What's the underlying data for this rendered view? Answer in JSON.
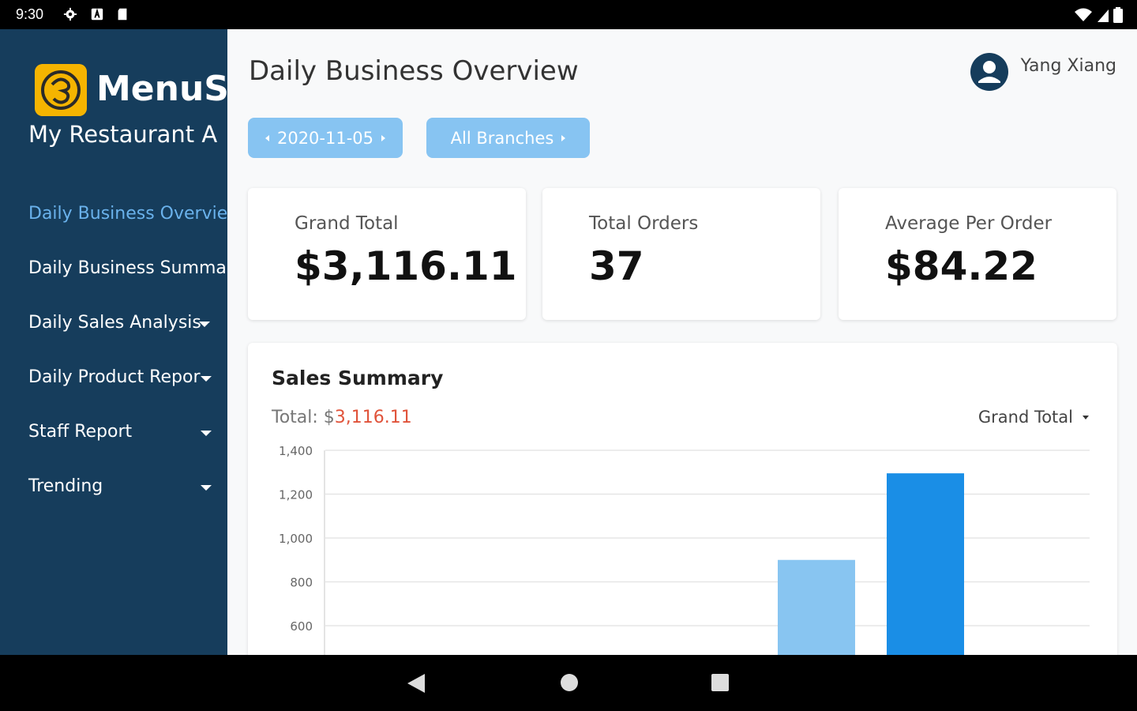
{
  "status_bar": {
    "time": "9:30",
    "left_icons": [
      "settings-icon",
      "notification-a-icon",
      "sd-card-icon"
    ],
    "right_icons": [
      "wifi-icon",
      "signal-icon",
      "battery-icon"
    ]
  },
  "sidebar": {
    "brand": "MenuSi",
    "restaurant": "My Restaurant A",
    "items": [
      {
        "label": "Daily Business Overvie",
        "active": true,
        "has_caret": false
      },
      {
        "label": "Daily Business Summa",
        "active": false,
        "has_caret": false
      },
      {
        "label": "Daily Sales Analysis",
        "active": false,
        "has_caret": true
      },
      {
        "label": "Daily Product Repor",
        "active": false,
        "has_caret": true
      },
      {
        "label": "Staff Report",
        "active": false,
        "has_caret": true
      },
      {
        "label": "Trending",
        "active": false,
        "has_caret": true
      }
    ]
  },
  "header": {
    "title": "Daily Business Overview",
    "user_name": "Yang Xiang"
  },
  "filters": {
    "date": "2020-11-05",
    "branch": "All Branches"
  },
  "kpis": [
    {
      "label": "Grand Total",
      "value": "$3,116.11"
    },
    {
      "label": "Total Orders",
      "value": "37"
    },
    {
      "label": "Average Per Order",
      "value": "$84.22"
    }
  ],
  "sales_summary": {
    "title": "Sales Summary",
    "total_label": "Total: $",
    "total_amount": "3,116.11",
    "metric": "Grand Total"
  },
  "chart_data": {
    "type": "bar",
    "y_ticks": [
      "1,400",
      "1,200",
      "1,000",
      "800",
      "600"
    ],
    "ylim": [
      600,
      1400
    ],
    "bars": [
      {
        "value": 900,
        "color": "#88c5f1"
      },
      {
        "value": 1295,
        "color": "#1a8ee6"
      }
    ]
  },
  "colors": {
    "sidebar_bg": "#163d5c",
    "active_nav": "#6ab2ec",
    "button_bg": "#87c4f2",
    "logo": "#f5b400",
    "total_amount": "#e0533a"
  },
  "nav_bar_icons": [
    "back-icon",
    "home-icon",
    "recents-icon"
  ]
}
